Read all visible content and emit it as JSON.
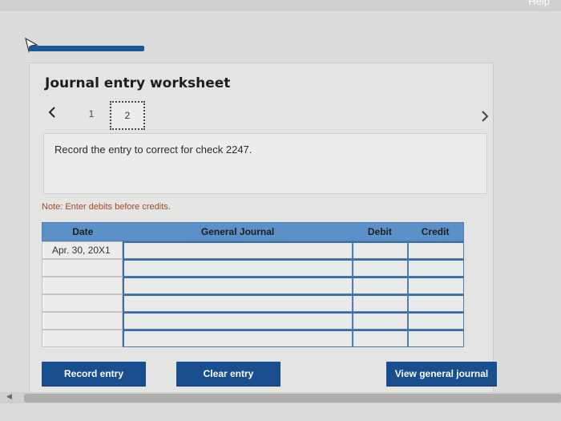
{
  "top": {
    "help_label": "Help"
  },
  "worksheet": {
    "title": "Journal entry worksheet",
    "pages": [
      "1",
      "2"
    ],
    "current_page": "2",
    "prompt": "Record the entry to correct for check 2247.",
    "note": "Note: Enter debits before credits."
  },
  "table": {
    "headers": {
      "date": "Date",
      "general_journal": "General Journal",
      "debit": "Debit",
      "credit": "Credit"
    },
    "rows": [
      {
        "date": "Apr. 30, 20X1",
        "general_journal": "",
        "debit": "",
        "credit": ""
      },
      {
        "date": "",
        "general_journal": "",
        "debit": "",
        "credit": ""
      },
      {
        "date": "",
        "general_journal": "",
        "debit": "",
        "credit": ""
      },
      {
        "date": "",
        "general_journal": "",
        "debit": "",
        "credit": ""
      },
      {
        "date": "",
        "general_journal": "",
        "debit": "",
        "credit": ""
      },
      {
        "date": "",
        "general_journal": "",
        "debit": "",
        "credit": ""
      }
    ]
  },
  "buttons": {
    "record": "Record entry",
    "clear": "Clear entry",
    "view": "View general journal"
  },
  "icons": {
    "prev": "chevron-left-icon",
    "next": "chevron-right-icon",
    "cursor": "mouse-pointer-icon"
  },
  "colors": {
    "header_blue": "#5c90c8",
    "button_blue": "#1a4f8f",
    "progress_blue": "#1d5799",
    "note_color": "#a04a2a"
  }
}
